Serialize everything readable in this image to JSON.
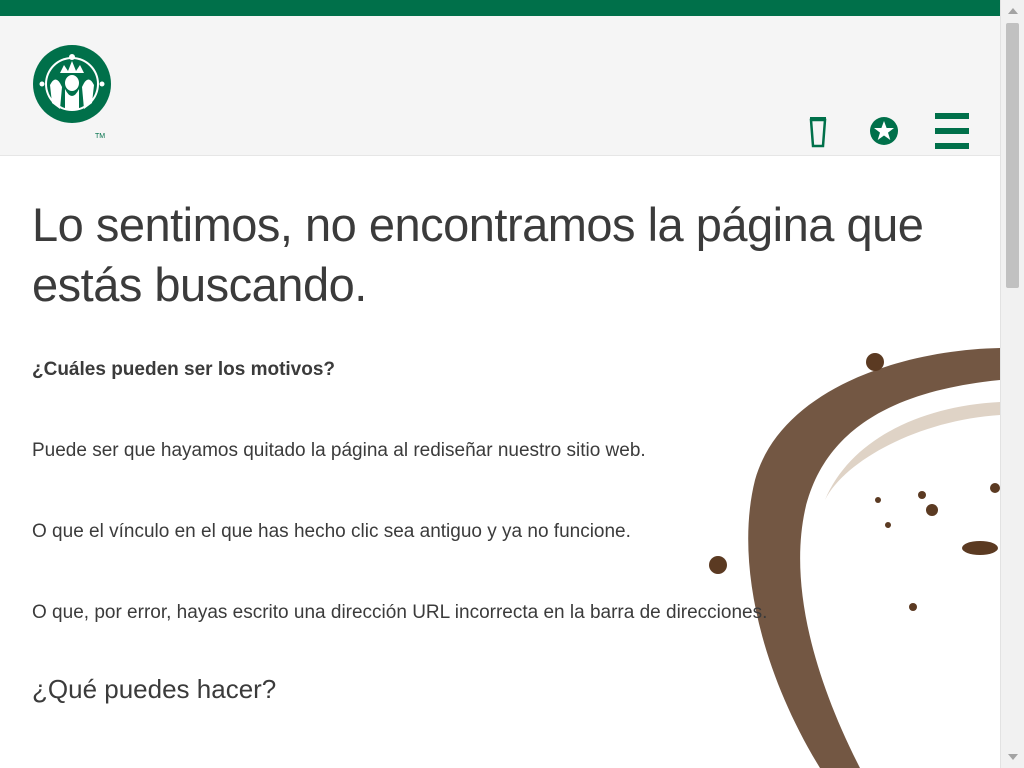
{
  "colors": {
    "brand_green": "#00704a",
    "text": "#3b3b3b",
    "header_bg": "#f5f5f5",
    "stain": "#5b3a22"
  },
  "header": {
    "logo_icon": "siren-logo-icon",
    "trademark": "TM",
    "icons": [
      "cup-icon",
      "star-icon",
      "hamburger-menu-icon"
    ]
  },
  "main": {
    "title": "Lo sentimos, no encontramos la página que estás buscando.",
    "reasons_heading": "¿Cuáles pueden ser los motivos?",
    "reason_1": "Puede ser que hayamos quitado la página al rediseñar nuestro sitio web.",
    "reason_2": "O que el vínculo en el que has hecho clic sea antiguo y ya no funcione.",
    "reason_3": "O que, por error, hayas escrito una dirección URL incorrecta en la barra de direcciones.",
    "what_heading": "¿Qué puedes hacer?"
  }
}
